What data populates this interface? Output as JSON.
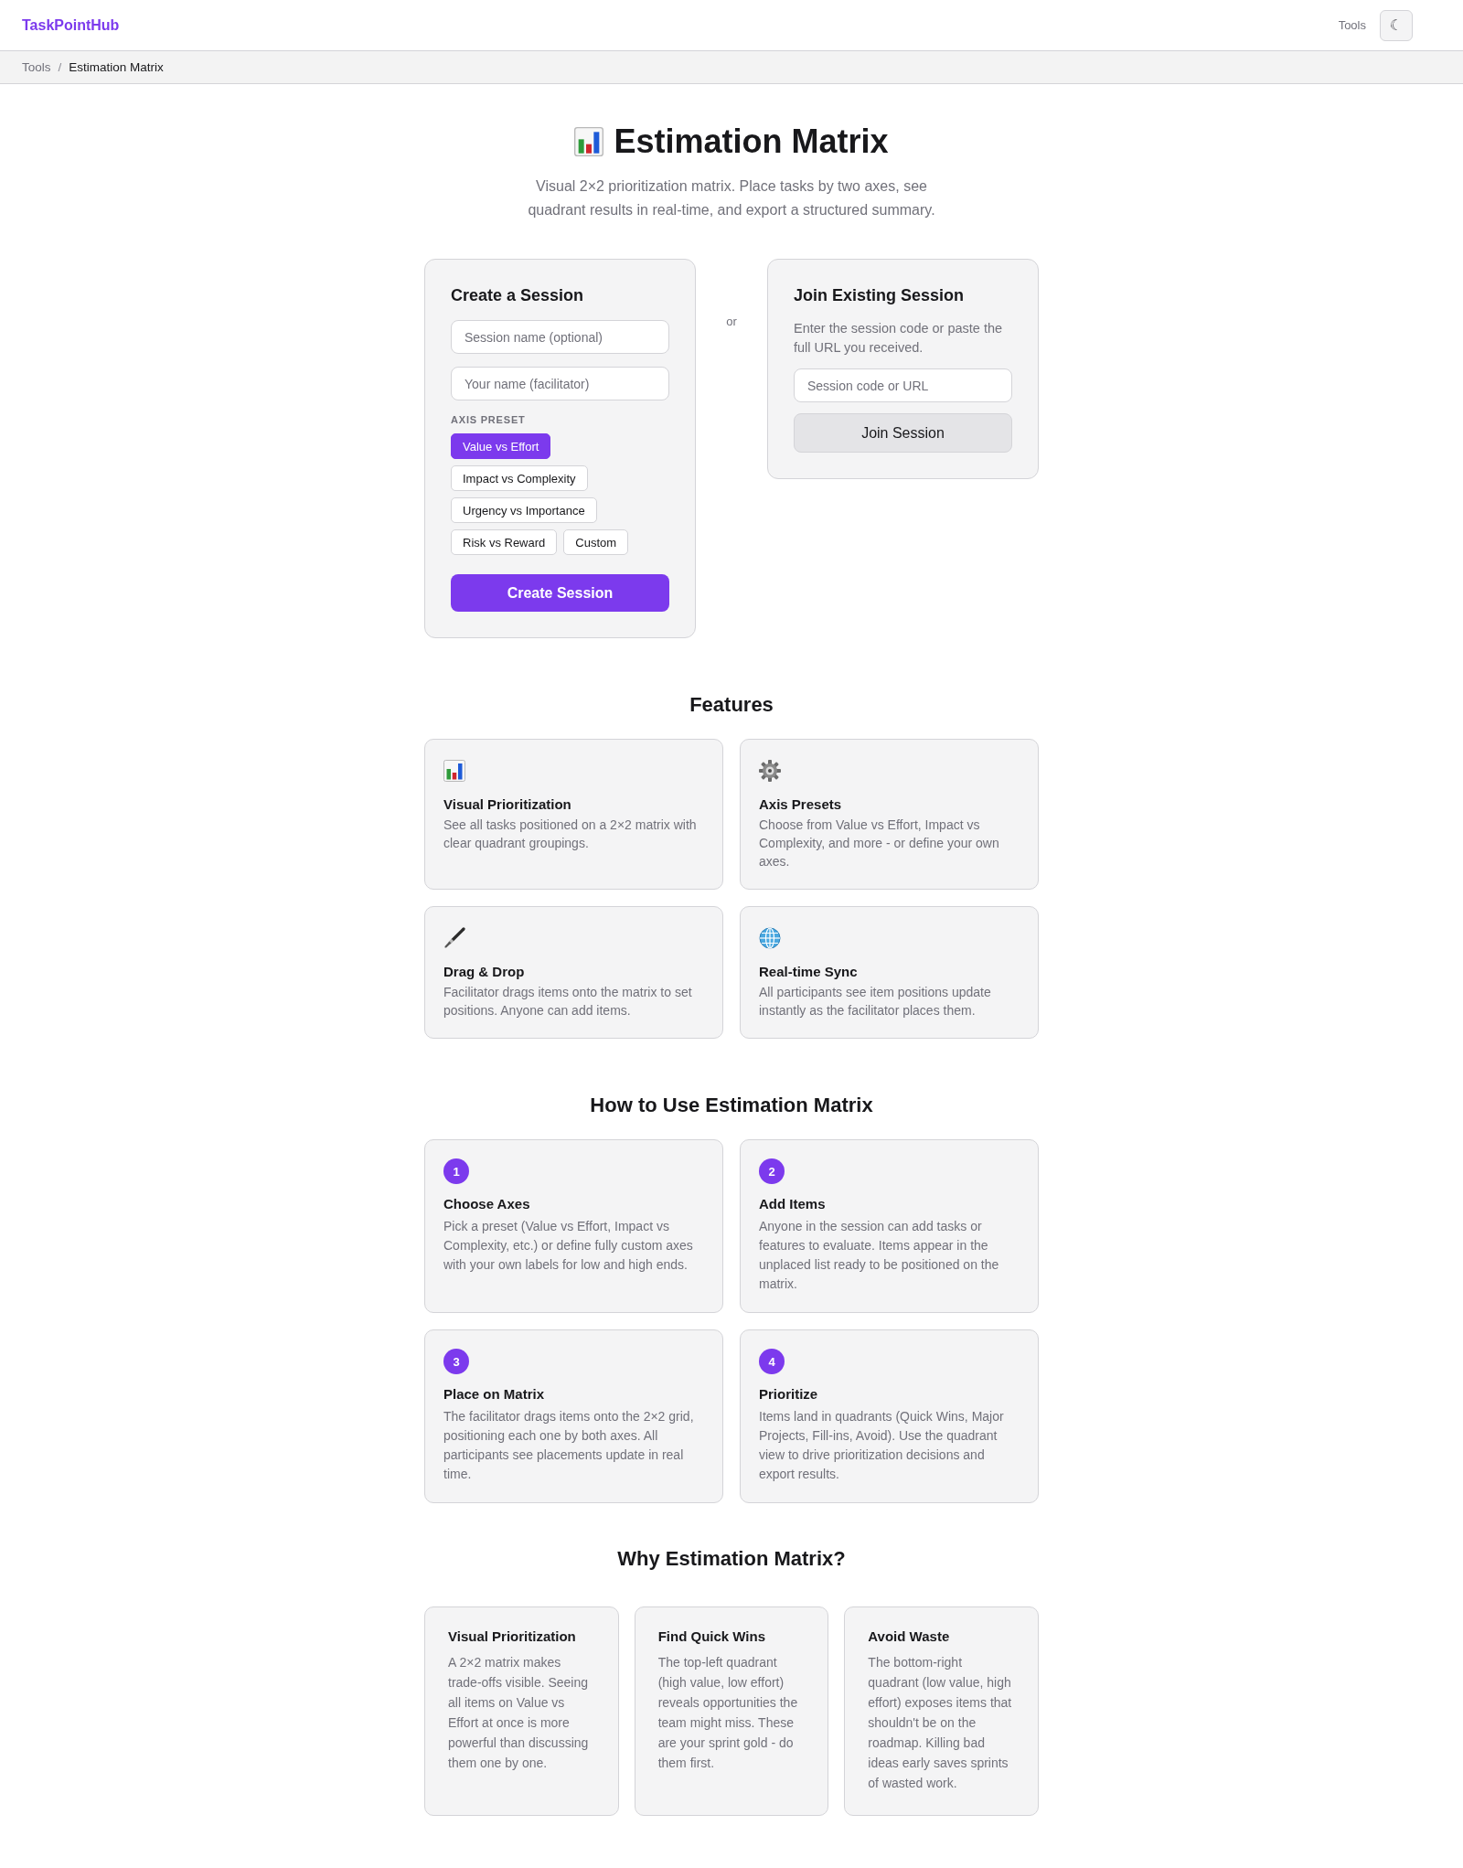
{
  "header": {
    "logo": "TaskPointHub",
    "nav_link": "Tools",
    "theme_toggle": "☾"
  },
  "breadcrumb": {
    "separator": "/",
    "items": [
      {
        "label": "Tools",
        "selected": false
      },
      {
        "label": "Estimation Matrix",
        "selected": true
      }
    ]
  },
  "hero": {
    "title": "Estimation Matrix",
    "subtitle": "Visual 2×2 prioritization matrix. Place tasks by two axes, see quadrant results in real-time, and export a structured summary."
  },
  "create_session": {
    "title": "Create a Session",
    "fields": [
      {
        "placeholder": "Session name (optional)"
      },
      {
        "placeholder": "Your name (facilitator)"
      }
    ],
    "preset_label": "AXIS PRESET",
    "presets": [
      {
        "label": "Value vs Effort",
        "selected": true
      },
      {
        "label": "Impact vs Complexity",
        "selected": false
      },
      {
        "label": "Urgency vs Importance",
        "selected": false
      },
      {
        "label": "Risk vs Reward",
        "selected": false
      },
      {
        "label": "Custom",
        "selected": false
      }
    ],
    "button": "Create Session"
  },
  "divider_text": "or",
  "join_session": {
    "title": "Join Existing Session",
    "description": "Enter the session code or paste the full URL you received.",
    "field": {
      "placeholder": "Session code or URL"
    },
    "button": "Join Session"
  },
  "features": {
    "title": "Features",
    "items": [
      {
        "kind": "chart",
        "title": "Visual Prioritization",
        "description": "See all tasks positioned on a 2×2 matrix with clear quadrant groupings."
      },
      {
        "kind": "gear",
        "title": "Axis Presets",
        "description": "Choose from Value vs Effort, Impact vs Complexity, and more - or define your own axes."
      },
      {
        "kind": "brush",
        "title": "Drag & Drop",
        "description": "Facilitator drags items onto the matrix to set positions. Anyone can add items."
      },
      {
        "kind": "globe",
        "title": "Real-time Sync",
        "description": "All participants see item positions update instantly as the facilitator places them."
      }
    ]
  },
  "how_to": {
    "title": "How to Use Estimation Matrix",
    "steps": [
      {
        "number": "1",
        "title": "Choose Axes",
        "description": "Pick a preset (Value vs Effort, Impact vs Complexity, etc.) or define fully custom axes with your own labels for low and high ends."
      },
      {
        "number": "2",
        "title": "Add Items",
        "description": "Anyone in the session can add tasks or features to evaluate. Items appear in the unplaced list ready to be positioned on the matrix."
      },
      {
        "number": "3",
        "title": "Place on Matrix",
        "description": "The facilitator drags items onto the 2×2 grid, positioning each one by both axes. All participants see placements update in real time."
      },
      {
        "number": "4",
        "title": "Prioritize",
        "description": "Items land in quadrants (Quick Wins, Major Projects, Fill-ins, Avoid). Use the quadrant view to drive prioritization decisions and export results."
      }
    ]
  },
  "why": {
    "title": "Why Estimation Matrix?",
    "items": [
      {
        "title": "Visual Prioritization",
        "description": "A 2×2 matrix makes trade-offs visible. Seeing all items on Value vs Effort at once is more powerful than discussing them one by one."
      },
      {
        "title": "Find Quick Wins",
        "description": "The top-left quadrant (high value, low effort) reveals opportunities the team might miss. These are your sprint gold - do them first."
      },
      {
        "title": "Avoid Waste",
        "description": "The bottom-right quadrant (low value, high effort) exposes items that shouldn't be on the roadmap. Killing bad ideas early saves sprints of wasted work."
      }
    ]
  }
}
